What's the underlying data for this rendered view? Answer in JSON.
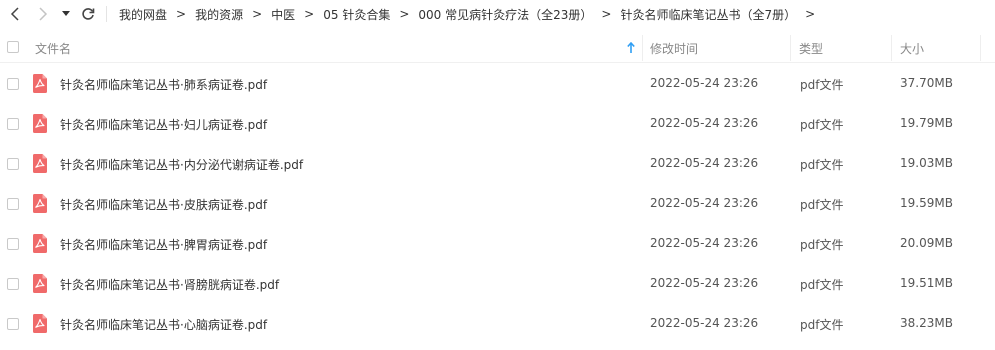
{
  "breadcrumb": [
    {
      "label": "我的网盘"
    },
    {
      "label": "我的资源"
    },
    {
      "label": "中医"
    },
    {
      "label": "05 针灸合集"
    },
    {
      "label": "000 常见病针灸疗法（全23册）"
    },
    {
      "label": "针灸名师临床笔记丛书（全7册）"
    }
  ],
  "separator": ">",
  "columns": {
    "name": "文件名",
    "modified": "修改时间",
    "type": "类型",
    "size": "大小"
  },
  "colors": {
    "pdf_icon": "#f06a6a",
    "sort_arrow": "#2f9ef4"
  },
  "icons": {
    "back": "chevron-left-icon",
    "forward": "chevron-right-icon",
    "history_dropdown": "caret-down-icon",
    "refresh": "refresh-icon",
    "sort": "arrow-up-icon",
    "file": "pdf-icon"
  },
  "files": [
    {
      "name": "针灸名师临床笔记丛书·肺系病证卷.pdf",
      "modified": "2022-05-24 23:26",
      "type": "pdf文件",
      "size": "37.70MB"
    },
    {
      "name": "针灸名师临床笔记丛书·妇儿病证卷.pdf",
      "modified": "2022-05-24 23:26",
      "type": "pdf文件",
      "size": "19.79MB"
    },
    {
      "name": "针灸名师临床笔记丛书·内分泌代谢病证卷.pdf",
      "modified": "2022-05-24 23:26",
      "type": "pdf文件",
      "size": "19.03MB"
    },
    {
      "name": "针灸名师临床笔记丛书·皮肤病证卷.pdf",
      "modified": "2022-05-24 23:26",
      "type": "pdf文件",
      "size": "19.59MB"
    },
    {
      "name": "针灸名师临床笔记丛书·脾胃病证卷.pdf",
      "modified": "2022-05-24 23:26",
      "type": "pdf文件",
      "size": "20.09MB"
    },
    {
      "name": "针灸名师临床笔记丛书·肾膀胱病证卷.pdf",
      "modified": "2022-05-24 23:26",
      "type": "pdf文件",
      "size": "19.51MB"
    },
    {
      "name": "针灸名师临床笔记丛书·心脑病证卷.pdf",
      "modified": "2022-05-24 23:26",
      "type": "pdf文件",
      "size": "38.23MB"
    }
  ]
}
